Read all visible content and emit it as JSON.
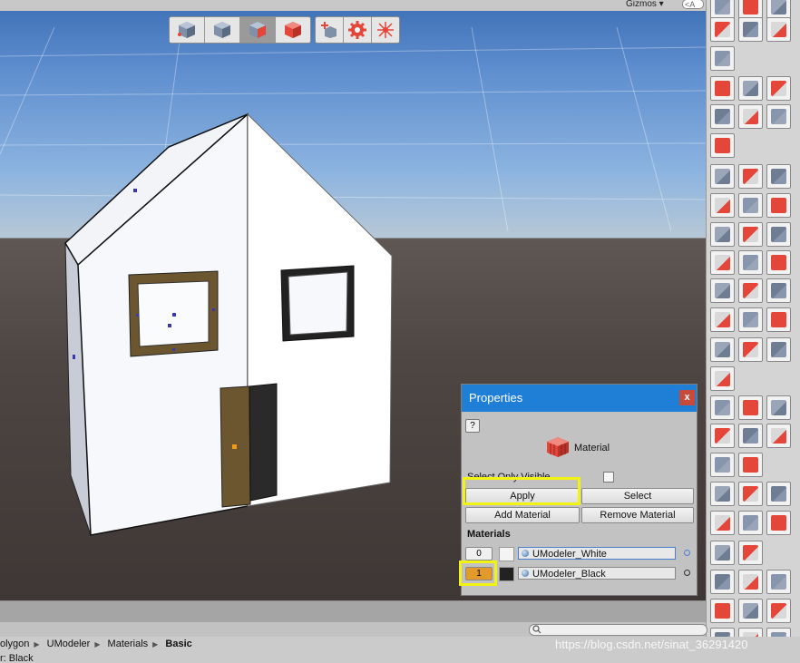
{
  "toolbar": {
    "gizmos_label": "Gizmos",
    "search_placeholder": "<A",
    "modes": [
      "object-mode",
      "vertex-mode",
      "edge-mode",
      "face-mode"
    ],
    "active_mode": "edge-mode",
    "extras": [
      "add-vertex",
      "settings",
      "pivot-tool"
    ]
  },
  "properties_panel": {
    "title": "Properties",
    "close_label": "x",
    "help_label": "?",
    "tool_name": "Material",
    "select_only_visible_label": "Select Only Visible",
    "select_only_visible_checked": false,
    "apply_label": "Apply",
    "select_label": "Select",
    "add_material_label": "Add Material",
    "remove_material_label": "Remove Material",
    "materials_heading": "Materials",
    "materials": [
      {
        "index": "0",
        "name": "UModeler_White",
        "swatch": "#f4f4f4",
        "selected": false
      },
      {
        "index": "1",
        "name": "UModeler_Black",
        "swatch": "#222222",
        "selected": true
      }
    ]
  },
  "breadcrumb": {
    "items": [
      "olygon",
      "UModeler",
      "Materials",
      "Basic"
    ]
  },
  "selection_text": "r: Black",
  "watermark": "https://blog.csdn.net/sinat_36291420",
  "colors": {
    "accent_blue": "#1f7fd6",
    "highlight_yellow": "#f2f213",
    "selected_index": "#e29a2a",
    "tool_red": "#e4473a"
  }
}
